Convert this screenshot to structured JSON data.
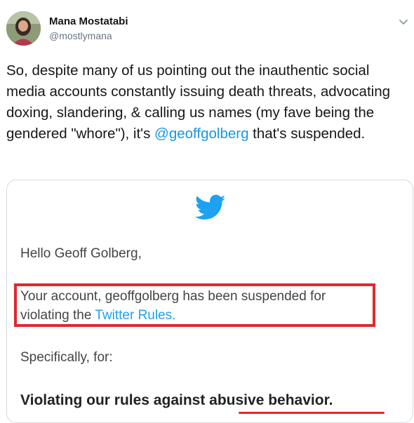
{
  "author": {
    "name": "Mana Mostatabi",
    "handle": "@mostlymana"
  },
  "tweet": {
    "text_before": "So, despite many of us pointing out the inauthentic social media accounts constantly issuing death threats, advocating doxing, slandering, & calling us names (my fave being the gendered \"whore\"), it's ",
    "mention": "@geoffgolberg",
    "text_after": " that's suspended."
  },
  "image": {
    "greeting": "Hello Geoff Golberg,",
    "suspension_line1": "Your account, geoffgolberg has been suspended for",
    "suspension_line2_prefix": "violating the ",
    "rules_link": "Twitter Rules.",
    "specifically": "Specifically, for:",
    "violation_prefix": "Violating our rules against ",
    "violation_reason": "abusive behavior."
  },
  "colors": {
    "accent": "#1b95e0",
    "highlight": "#e0282e"
  },
  "icons": {
    "menu": "chevron-down-icon",
    "brand": "twitter-bird-icon"
  }
}
